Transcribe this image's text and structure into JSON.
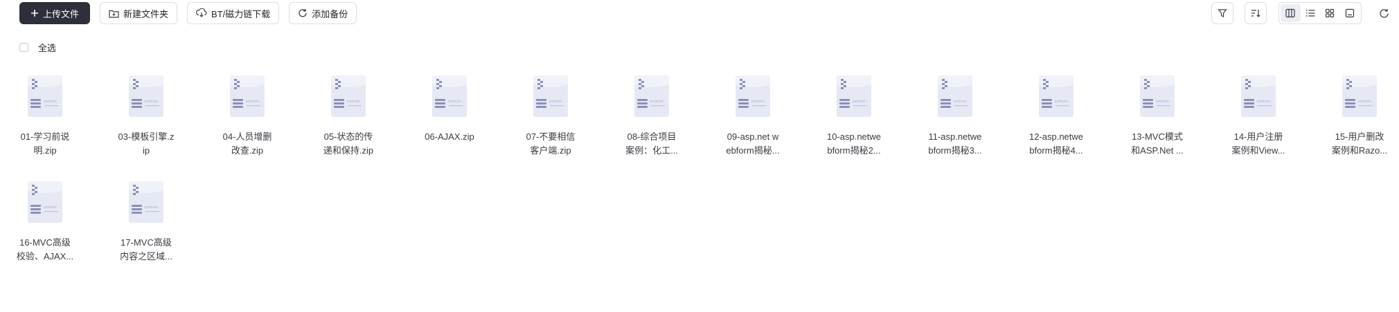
{
  "toolbar": {
    "upload": "上传文件",
    "new_folder": "新建文件夹",
    "bt_download": "BT/磁力链下载",
    "add_backup": "添加备份"
  },
  "select_all_label": "全选",
  "icons": {
    "filter": "filter-icon",
    "sort": "sort-icon",
    "view_column": "column-view-icon",
    "view_list": "list-view-icon",
    "view_grid": "grid-view-icon",
    "view_large": "large-thumbnail-icon",
    "refresh": "refresh-icon",
    "zip": "zip-file-icon"
  },
  "zip_icon_text": "ZIP/RAR/...",
  "colors": {
    "primary_button": "#2d2f3a",
    "zip_icon_body": "#e3e6f3",
    "zip_icon_accent": "#8a90b7"
  },
  "files": [
    [
      "01-学习前说",
      "明.zip"
    ],
    [
      "03-模板引擎.z",
      "ip"
    ],
    [
      "04-人员增删",
      "改查.zip"
    ],
    [
      "05-状态的传",
      "递和保持.zip"
    ],
    [
      "06-AJAX.zip"
    ],
    [
      "07-不要相信",
      "客户端.zip"
    ],
    [
      "08-综合项目",
      "案例：化工..."
    ],
    [
      "09-asp.net w",
      "ebform揭秘..."
    ],
    [
      "10-asp.netwe",
      "bform揭秘2..."
    ],
    [
      "11-asp.netwe",
      "bform揭秘3..."
    ],
    [
      "12-asp.netwe",
      "bform揭秘4..."
    ],
    [
      "13-MVC模式",
      "和ASP.Net ..."
    ],
    [
      "14-用户注册",
      "案例和View..."
    ],
    [
      "15-用户删改",
      "案例和Razo..."
    ],
    [
      "16-MVC高级",
      "校验、AJAX..."
    ],
    [
      "17-MVC高级",
      "内容之区域..."
    ]
  ]
}
